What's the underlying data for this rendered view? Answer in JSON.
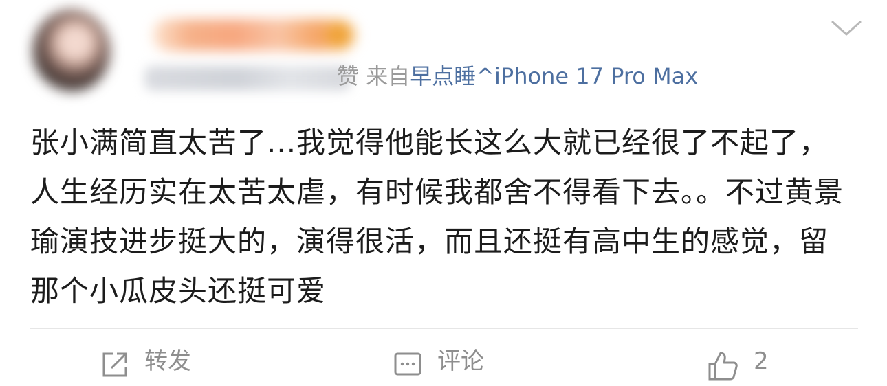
{
  "post": {
    "meta": {
      "partial_char": "赞",
      "from_label": "来自",
      "source": "早点睡^iPhone 17 Pro Max"
    },
    "text": "张小满简直太苦了...我觉得他能长这么大就已经很了不起了，人生经历实在太苦太虐，有时候我都舍不得看下去。。不过黄景瑜演技进步挺大的，演得很活，而且还挺有高中生的感觉，留那个小瓜皮头还挺可爱"
  },
  "actions": {
    "repost_label": "转发",
    "comment_label": "评论",
    "like_count": "2"
  },
  "icons": {
    "menu": "chevron-down-icon",
    "repost": "repost-icon",
    "comment": "comment-icon",
    "like": "thumbs-up-icon"
  },
  "colors": {
    "source_link": "#4d6fa0",
    "meta_gray": "#9a9a9a",
    "action_gray": "#8e8e8e"
  }
}
